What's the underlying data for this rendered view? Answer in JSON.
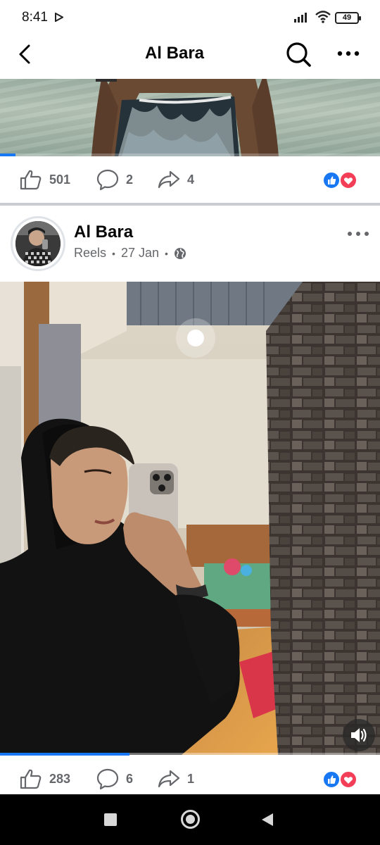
{
  "status_bar": {
    "time": "8:41",
    "battery": "49"
  },
  "header": {
    "title": "Al Bara",
    "icons": [
      "back-arrow-icon",
      "search-icon",
      "more-icon"
    ]
  },
  "post1": {
    "video_progress": 0.04,
    "likes": "501",
    "comments": "2",
    "shares": "4",
    "reactions": [
      "like",
      "love"
    ]
  },
  "post2": {
    "author": "Al Bara",
    "type": "Reels",
    "date": "27 Jan",
    "audience_icon": "globe-icon",
    "video_progress": 0.34,
    "likes": "283",
    "comments": "6",
    "shares": "1",
    "reactions": [
      "like",
      "love"
    ]
  },
  "colors": {
    "accent": "#1877f2",
    "like": "#1877f2",
    "love": "#f33e58",
    "secondary_text": "#65676b"
  },
  "navbar": {
    "icons": [
      "recent-apps-icon",
      "home-icon",
      "back-icon"
    ]
  }
}
